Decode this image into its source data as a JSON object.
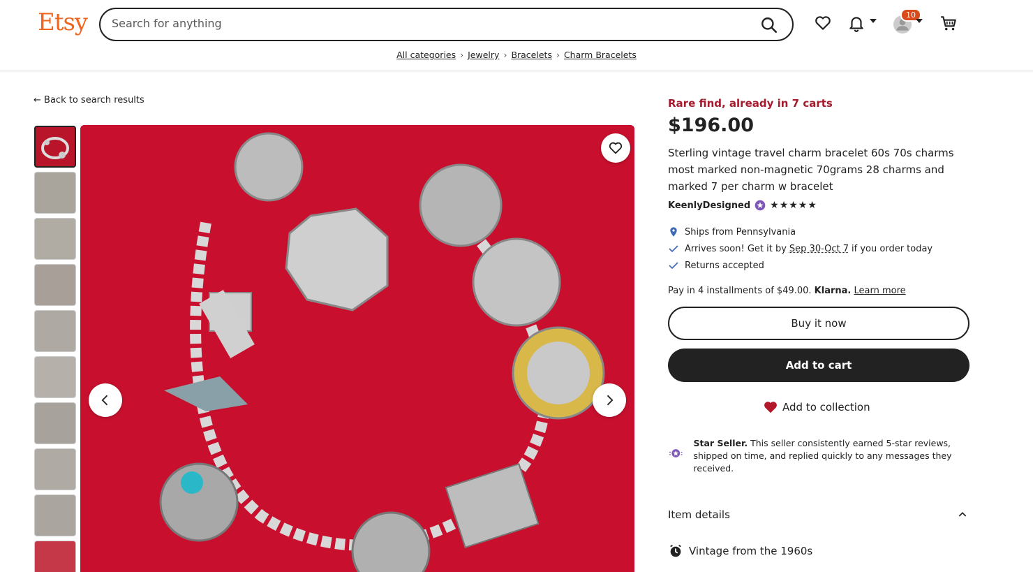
{
  "header": {
    "logo": "Etsy",
    "search_placeholder": "Search for anything",
    "notification_count": "10"
  },
  "breadcrumb": [
    "All categories",
    "Jewelry",
    "Bracelets",
    "Charm Bracelets"
  ],
  "back_link": "Back to search results",
  "product": {
    "rare_find": "Rare find, already in 7 carts",
    "price": "$196.00",
    "title": "Sterling vintage travel charm bracelet 60s 70s charms most marked non-magnetic 70grams 28 charms and marked 7 per charm w bracelet",
    "shop_name": "KeenlyDesigned",
    "stars": "★★★★★",
    "ships_from": "Ships from Pennsylvania",
    "arrival_prefix": "Arrives soon! Get it by",
    "arrival_dates": "Sep 30-Oct 7",
    "arrival_suffix": "if you order today",
    "returns": "Returns accepted",
    "installments": "Pay in 4 installments of $49.00.",
    "klarna": "Klarna.",
    "learn_more": "Learn more",
    "buy_now": "Buy it now",
    "add_to_cart": "Add to cart",
    "add_to_collection": "Add to collection",
    "star_seller_title": "Star Seller.",
    "star_seller_text": "This seller consistently earned 5-star reviews, shipped on time, and replied quickly to any messages they received.",
    "item_details": "Item details",
    "vintage": "Vintage from the 1960s"
  },
  "colors": {
    "brand": "#f1641e",
    "rare": "#a61a2e",
    "image_bg": "#c8102e",
    "star_seller": "#7f57b8"
  }
}
